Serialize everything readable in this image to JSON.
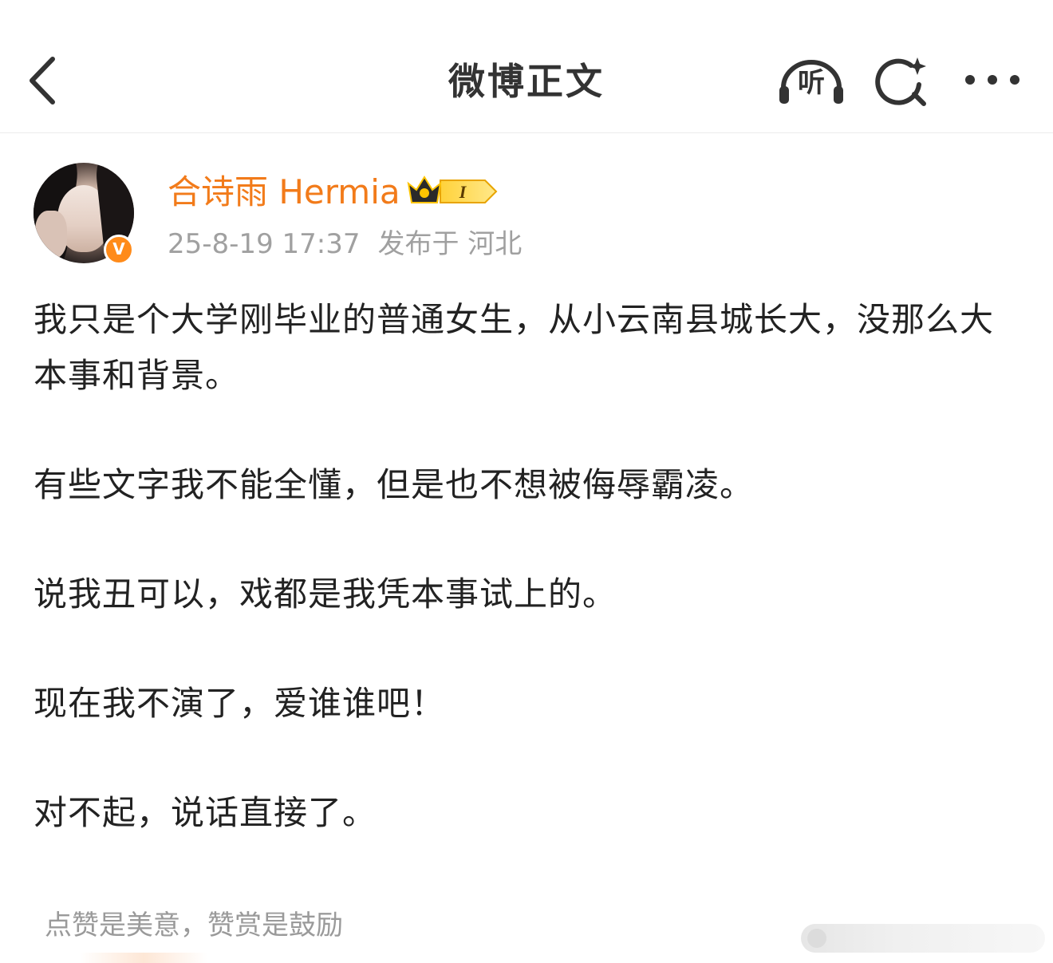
{
  "header": {
    "title": "微博正文",
    "listen_label": "听"
  },
  "author": {
    "name": "合诗雨 Hermia",
    "vip_level": "I",
    "verified_mark": "V",
    "date": "25-8-19 17:37",
    "location": "发布于 河北"
  },
  "post": {
    "paragraphs": [
      "我只是个大学刚毕业的普通女生，从小云南县城长大，没那么大本事和背景。",
      "有些文字我不能全懂，但是也不想被侮辱霸凌。",
      "说我丑可以，戏都是我凭本事试上的。",
      "现在我不演了，爱谁谁吧！",
      "对不起，说话直接了。"
    ]
  },
  "footer": {
    "reward_text": "点赞是美意，赞赏是鼓励"
  },
  "colors": {
    "accent_orange": "#f27b1a",
    "verified_orange": "#ff8b1a",
    "meta_gray": "#a0a0a0",
    "text_dark": "#222222"
  },
  "icons": {
    "back": "chevron-left-icon",
    "listen": "headphones-icon",
    "search": "ai-search-icon",
    "more": "more-dots-icon"
  }
}
